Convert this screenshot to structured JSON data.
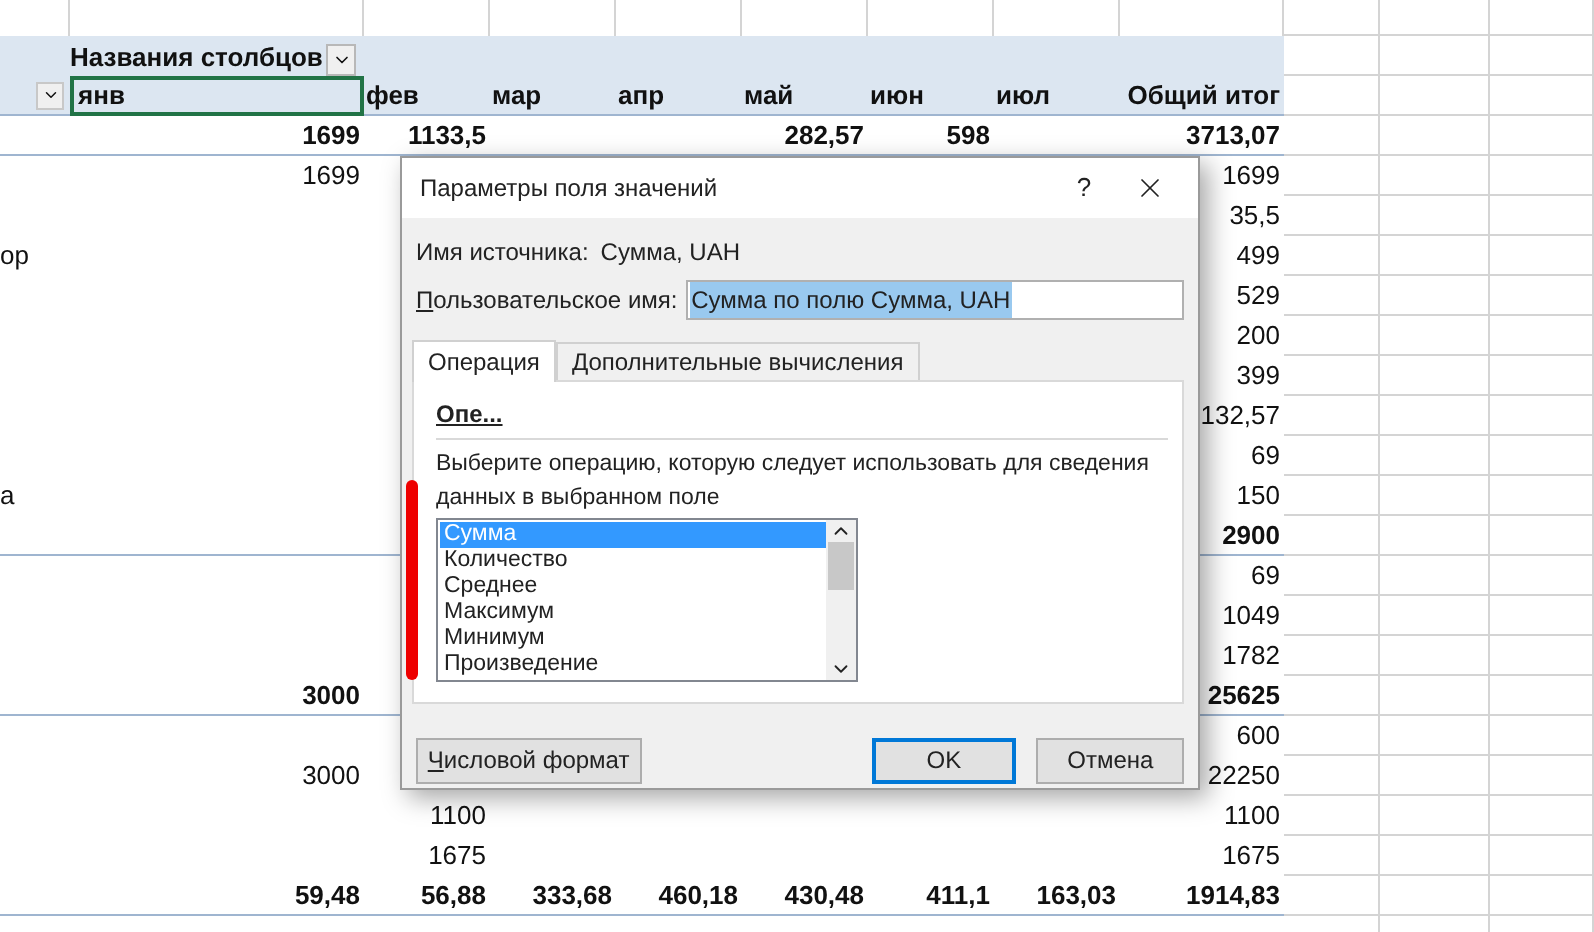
{
  "spreadsheet": {
    "column_field_label": "Названия столбцов",
    "column_headers": [
      "янв",
      "фев",
      "мар",
      "апр",
      "май",
      "июн",
      "июл",
      "Общий итог"
    ],
    "rows": [
      {
        "bold": true,
        "rule_below": true,
        "cells": {
          "jan": "1699",
          "feb": "1133,5",
          "may": "282,57",
          "jun": "598",
          "total": "3713,07"
        }
      },
      {
        "bold": false,
        "rule_below": false,
        "cells": {
          "jan": "1699",
          "total": "1699"
        }
      },
      {
        "bold": false,
        "rule_below": false,
        "cells": {
          "total": "35,5"
        }
      },
      {
        "label": "ор",
        "bold": false,
        "rule_below": false,
        "cells": {
          "total": "499"
        }
      },
      {
        "bold": false,
        "rule_below": false,
        "cells": {
          "total": "529"
        }
      },
      {
        "bold": false,
        "rule_below": false,
        "cells": {
          "total": "200"
        }
      },
      {
        "bold": false,
        "rule_below": false,
        "cells": {
          "total": "399"
        }
      },
      {
        "bold": false,
        "rule_below": false,
        "cells": {
          "total": "132,57"
        }
      },
      {
        "bold": false,
        "rule_below": false,
        "cells": {
          "total": "69"
        }
      },
      {
        "label": "а",
        "bold": false,
        "rule_below": false,
        "cells": {
          "total": "150"
        }
      },
      {
        "bold": true,
        "rule_below": true,
        "cells": {
          "total": "2900"
        }
      },
      {
        "bold": false,
        "rule_below": false,
        "cells": {
          "total": "69"
        }
      },
      {
        "bold": false,
        "rule_below": false,
        "cells": {
          "total": "1049"
        }
      },
      {
        "bold": false,
        "rule_below": false,
        "cells": {
          "total": "1782"
        }
      },
      {
        "bold": true,
        "rule_below": true,
        "cells": {
          "jan": "3000",
          "total": "25625"
        }
      },
      {
        "bold": false,
        "rule_below": false,
        "cells": {
          "total": "600"
        }
      },
      {
        "bold": false,
        "rule_below": false,
        "cells": {
          "jan": "3000",
          "total": "22250"
        }
      },
      {
        "bold": false,
        "rule_below": false,
        "cells": {
          "feb": "1100",
          "total": "1100"
        }
      },
      {
        "bold": false,
        "rule_below": false,
        "cells": {
          "feb": "1675",
          "total": "1675"
        }
      },
      {
        "bold": true,
        "rule_below": true,
        "cells": {
          "jan": "59,48",
          "feb": "56,88",
          "mar": "333,68",
          "apr": "460,18",
          "may": "430,48",
          "jun": "411,1",
          "jul": "163,03",
          "total": "1914,83"
        }
      }
    ]
  },
  "dialog": {
    "title": "Параметры поля значений",
    "help_button": "?",
    "source_label": "Имя источника:",
    "source_value": "Сумма, UAH",
    "custom_name_label": "Пользовательское имя:",
    "custom_name_value": "Сумма по полю Сумма, UAH",
    "tabs": [
      {
        "label": "Операция",
        "selected": true
      },
      {
        "label": "Дополнительные вычисления",
        "selected": false
      }
    ],
    "section_heading": "Опе...",
    "description": "Выберите операцию, которую следует использовать для сведения данных в выбранном поле",
    "operations": [
      {
        "label": "Сумма",
        "selected": true
      },
      {
        "label": "Количество",
        "selected": false
      },
      {
        "label": "Среднее",
        "selected": false
      },
      {
        "label": "Максимум",
        "selected": false
      },
      {
        "label": "Минимум",
        "selected": false
      },
      {
        "label": "Произведение",
        "selected": false
      }
    ],
    "buttons": [
      {
        "label": "Числовой формат",
        "kind": "secondary"
      },
      {
        "label": "OK",
        "kind": "default"
      },
      {
        "label": "Отмена",
        "kind": "cancel"
      }
    ]
  }
}
